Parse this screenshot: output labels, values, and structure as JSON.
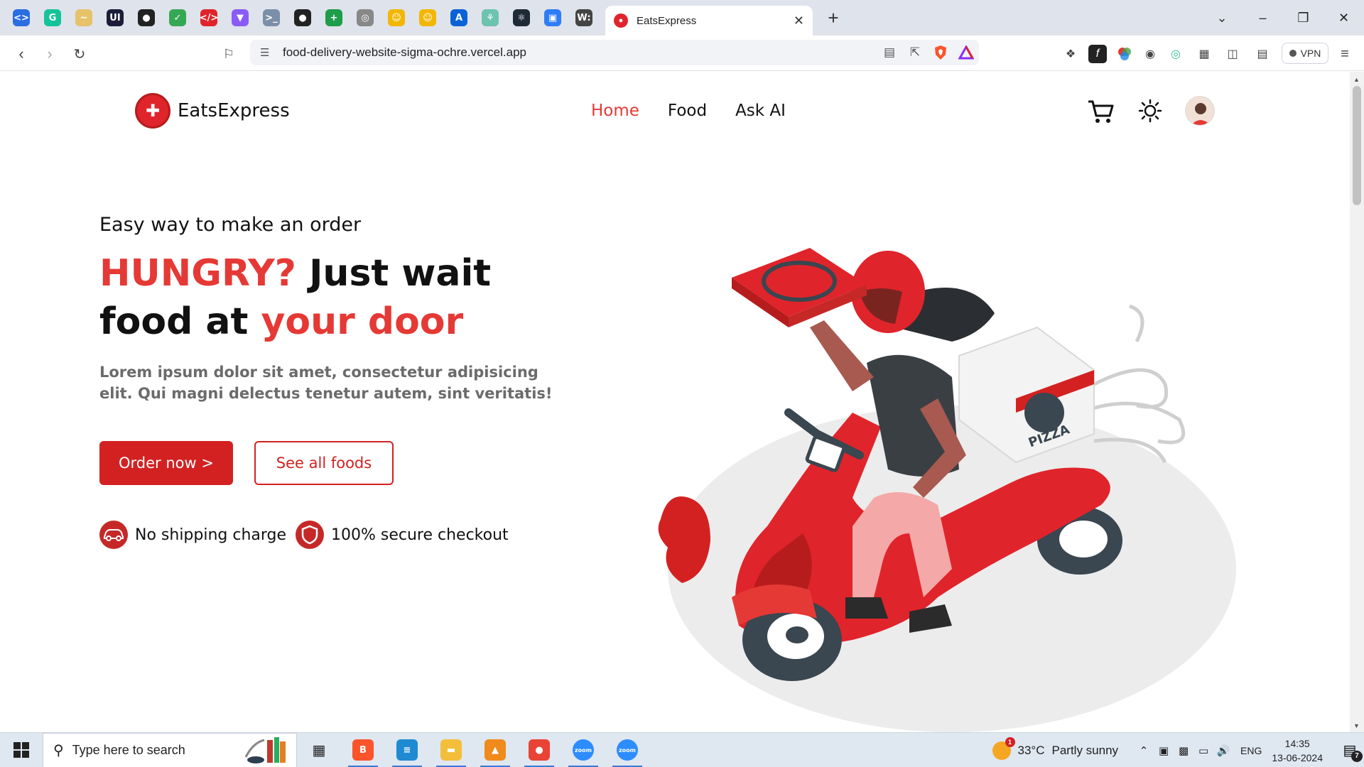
{
  "browser": {
    "pinned_tabs": [
      {
        "icon": "code-icon",
        "glyph": "<>",
        "color": "#2b6de1"
      },
      {
        "icon": "grammarly-icon",
        "glyph": "G",
        "color": "#15c39a"
      },
      {
        "icon": "bone-icon",
        "glyph": "~",
        "color": "#e6c36a"
      },
      {
        "icon": "ui-icon",
        "glyph": "UI",
        "color": "#1c1c3a"
      },
      {
        "icon": "github-icon",
        "glyph": "●",
        "color": "#222222"
      },
      {
        "icon": "leaf-icon",
        "glyph": "✓",
        "color": "#35a853"
      },
      {
        "icon": "html-icon",
        "glyph": "</>",
        "color": "#e0242b"
      },
      {
        "icon": "vite-icon",
        "glyph": "▼",
        "color": "#8a5cf6"
      },
      {
        "icon": "terminal-icon",
        "glyph": ">_",
        "color": "#7c8fa8"
      },
      {
        "icon": "github-icon",
        "glyph": "●",
        "color": "#222222"
      },
      {
        "icon": "sheets-icon",
        "glyph": "+",
        "color": "#1e9d4b"
      },
      {
        "icon": "camera-icon",
        "glyph": "◎",
        "color": "#888888"
      },
      {
        "icon": "emoji-icon",
        "glyph": "☺",
        "color": "#f2b705"
      },
      {
        "icon": "emoji-icon",
        "glyph": "☺",
        "color": "#f2b705"
      },
      {
        "icon": "azure-icon",
        "glyph": "A",
        "color": "#0a63d6"
      },
      {
        "icon": "leaf-icon",
        "glyph": "⚘",
        "color": "#6cc3b0"
      },
      {
        "icon": "react-icon",
        "glyph": "⚛",
        "color": "#1f2a37"
      },
      {
        "icon": "window-icon",
        "glyph": "▣",
        "color": "#2f7df6"
      },
      {
        "icon": "wiki-icon",
        "glyph": "W:",
        "color": "#444444"
      }
    ],
    "active_tab": {
      "title": "EatsExpress",
      "close": "✕"
    },
    "new_tab": "+",
    "tab_list": "⌄",
    "window_controls": {
      "minimize": "–",
      "maximize": "❐",
      "close": "✕"
    },
    "nav": {
      "back": "‹",
      "forward": "›",
      "reload": "↻",
      "bookmark": "⚐"
    },
    "url": "food-delivery-website-sigma-ochre.vercel.app",
    "omnibox_icons": {
      "site_settings": "☰",
      "reader": "▤",
      "share": "⇱"
    },
    "vpn_label": "VPN"
  },
  "site": {
    "brand": "EatsExpress",
    "nav": [
      {
        "label": "Home",
        "active": true
      },
      {
        "label": "Food",
        "active": false
      },
      {
        "label": "Ask AI",
        "active": false
      }
    ],
    "hero": {
      "kicker": "Easy way to make an order",
      "headline_red1": "HUNGRY?",
      "headline_black1": " Just wait food at ",
      "headline_red2": "your door",
      "lead": "Lorem ipsum dolor sit amet, consectetur adipisicing elit. Qui magni delectus tenetur autem, sint veritatis!",
      "order_button": "Order now >",
      "foods_button": "See all foods",
      "features": [
        {
          "icon": "car-icon",
          "label": "No shipping charge"
        },
        {
          "icon": "shield-icon",
          "label": "100% secure checkout"
        }
      ],
      "box_text": "PIZZA"
    },
    "accent": "#e53935"
  },
  "taskbar": {
    "search_placeholder": "Type here to search",
    "apps": [
      {
        "name": "brave",
        "glyph": "B",
        "color": "#fb542b",
        "running": true
      },
      {
        "name": "vscode",
        "glyph": "≡",
        "color": "#1f8ad2",
        "running": true
      },
      {
        "name": "files",
        "glyph": "▬",
        "color": "#f3bf3a",
        "running": true
      },
      {
        "name": "vlc",
        "glyph": "▲",
        "color": "#f08a1c",
        "running": true
      },
      {
        "name": "chrome",
        "glyph": "●",
        "color": "#e94335",
        "running": true
      },
      {
        "name": "zoom",
        "glyph": "zoom",
        "color": "#2d8cff",
        "running": true
      },
      {
        "name": "zoom",
        "glyph": "zoom",
        "color": "#2d8cff",
        "running": true
      }
    ],
    "weather": {
      "temp": "33°C",
      "desc": "Partly sunny",
      "badge": "1"
    },
    "language": "ENG",
    "time": "14:35",
    "date": "13-06-2024",
    "notification_count": "7"
  }
}
